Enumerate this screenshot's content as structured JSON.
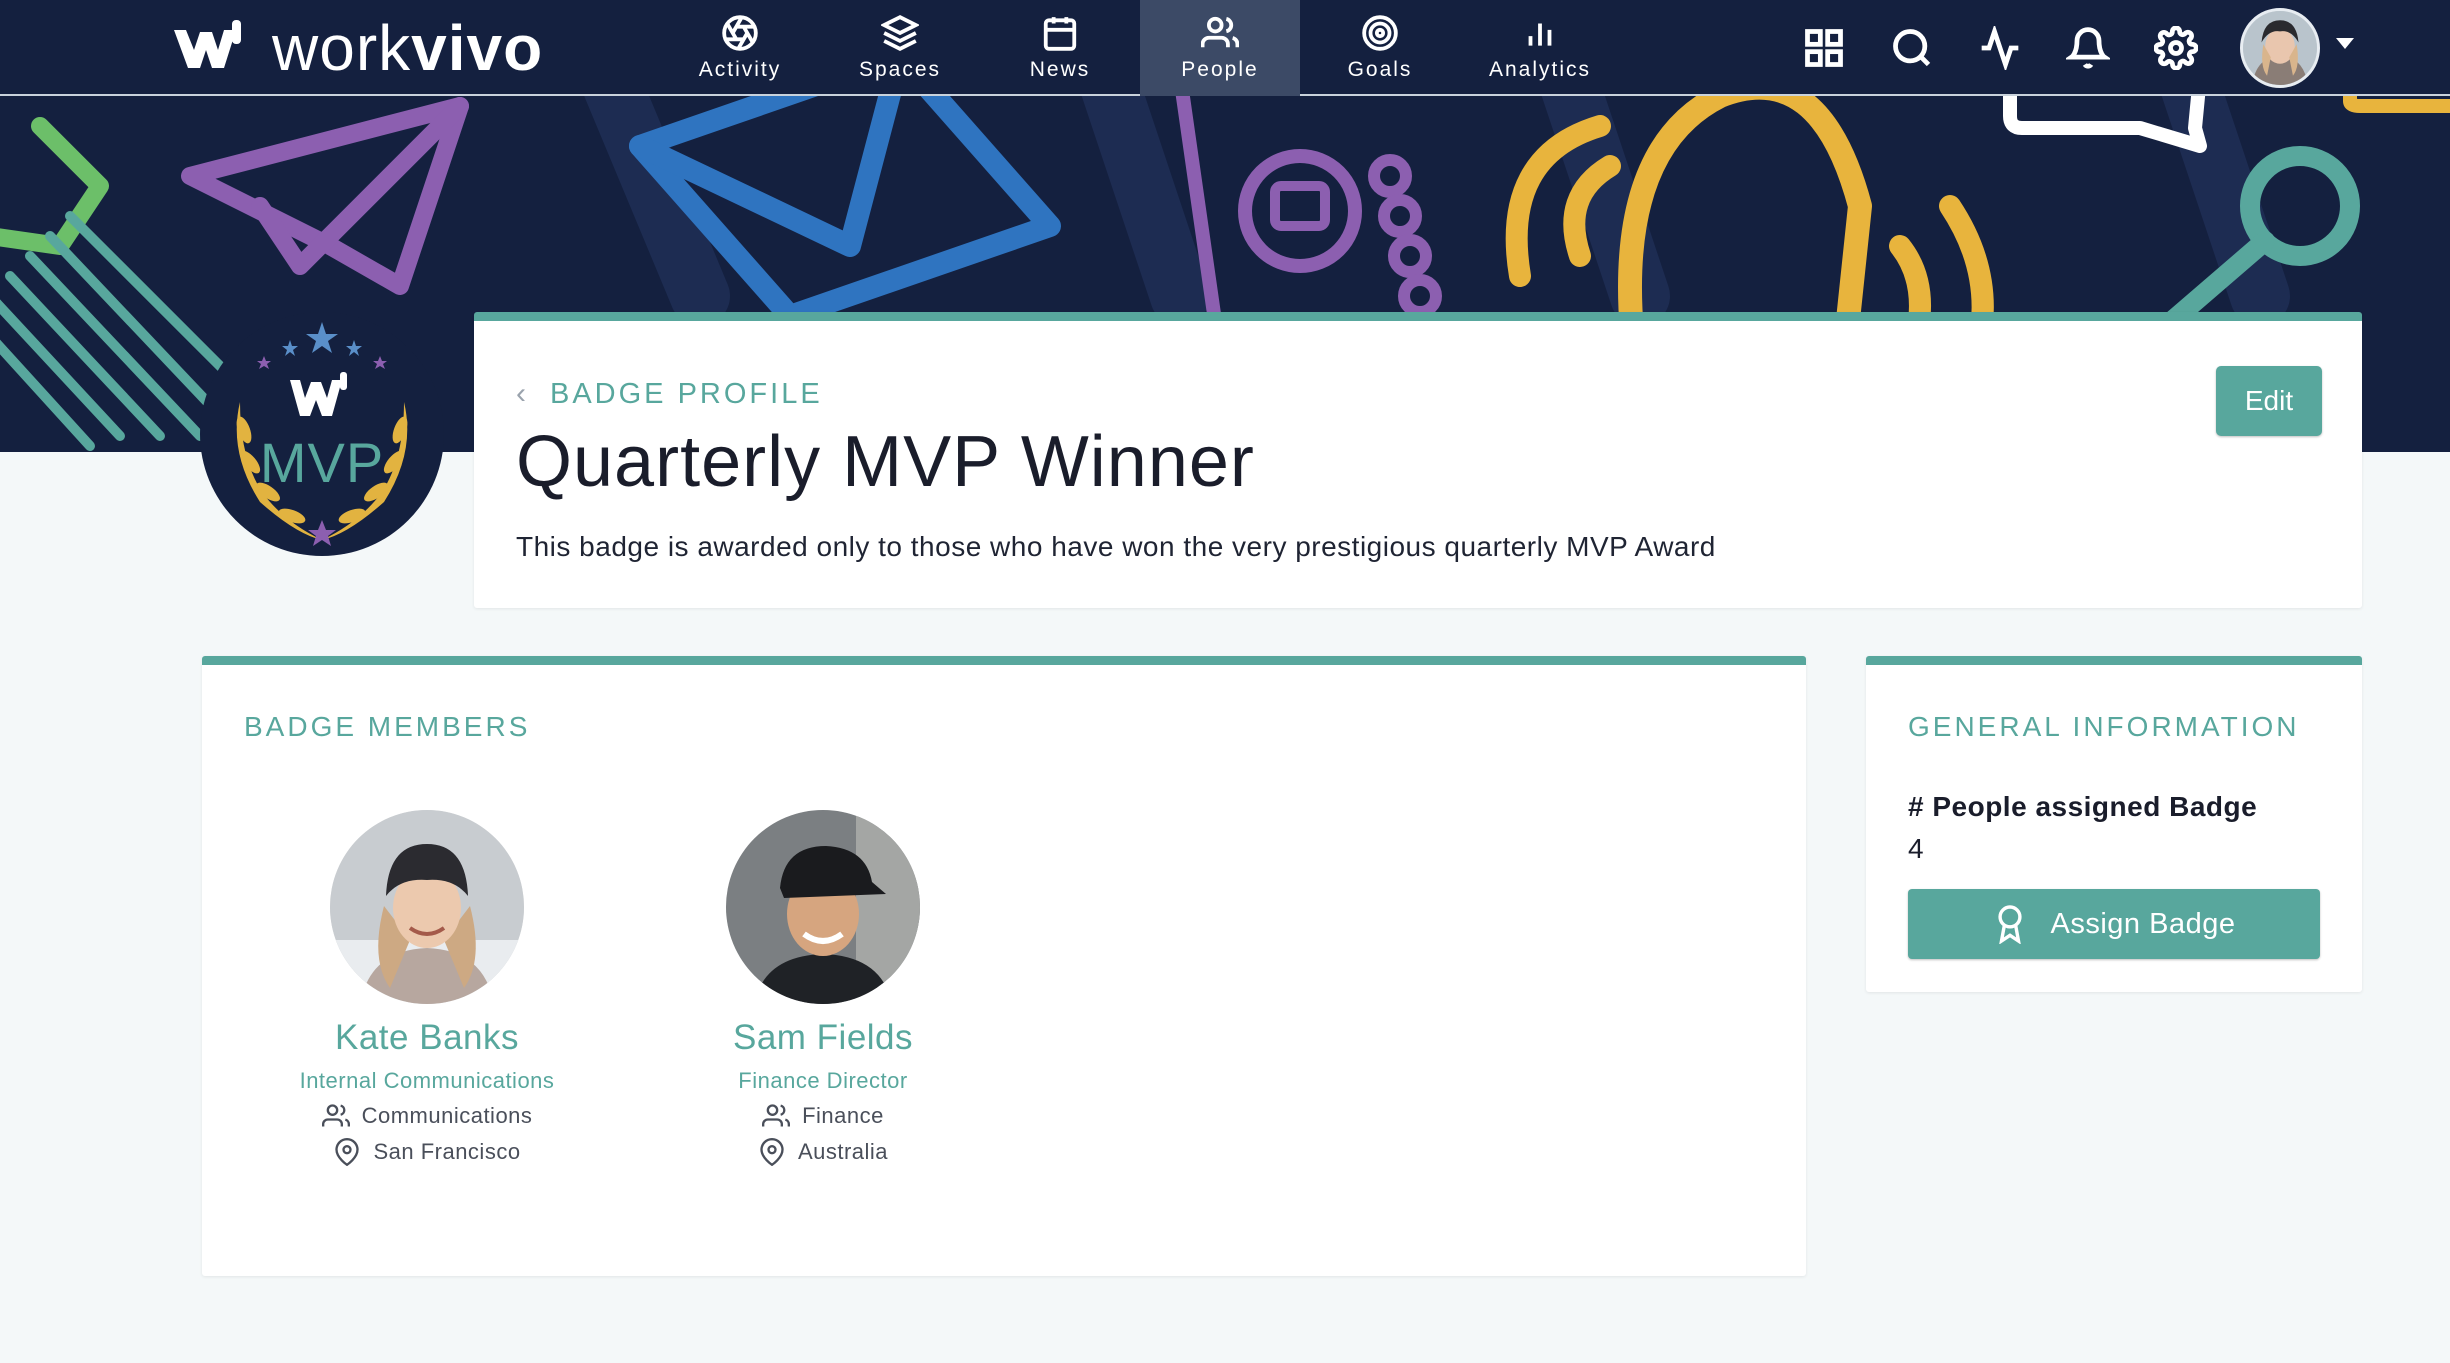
{
  "brand": {
    "name_light": "work",
    "name_bold": "vivo"
  },
  "nav": {
    "items": [
      {
        "label": "Activity",
        "icon": "aperture-icon"
      },
      {
        "label": "Spaces",
        "icon": "layers-icon"
      },
      {
        "label": "News",
        "icon": "calendar-icon"
      },
      {
        "label": "People",
        "icon": "people-icon",
        "active": true
      },
      {
        "label": "Goals",
        "icon": "target-icon"
      },
      {
        "label": "Analytics",
        "icon": "bar-chart-icon"
      }
    ],
    "right_icons": [
      "grid-icon",
      "search-icon",
      "activity-pulse-icon",
      "bell-icon",
      "gear-icon"
    ]
  },
  "badge": {
    "emblem_text": "MVP",
    "breadcrumb": "BADGE PROFILE",
    "title": "Quarterly MVP Winner",
    "description": "This badge is awarded only to those who have won the very prestigious quarterly MVP Award",
    "edit_label": "Edit"
  },
  "members": {
    "title": "BADGE MEMBERS",
    "list": [
      {
        "name": "Kate Banks",
        "role": "Internal Communications",
        "department": "Communications",
        "location": "San Francisco"
      },
      {
        "name": "Sam Fields",
        "role": "Finance Director",
        "department": "Finance",
        "location": "Australia"
      }
    ]
  },
  "info": {
    "title": "GENERAL INFORMATION",
    "people_label": "# People assigned Badge",
    "people_count": "4",
    "assign_label": "Assign Badge"
  },
  "colors": {
    "accent": "#58a79d",
    "nav_bg": "#14203f",
    "nav_active": "#3c4a66",
    "page_bg": "#f4f8f9"
  }
}
